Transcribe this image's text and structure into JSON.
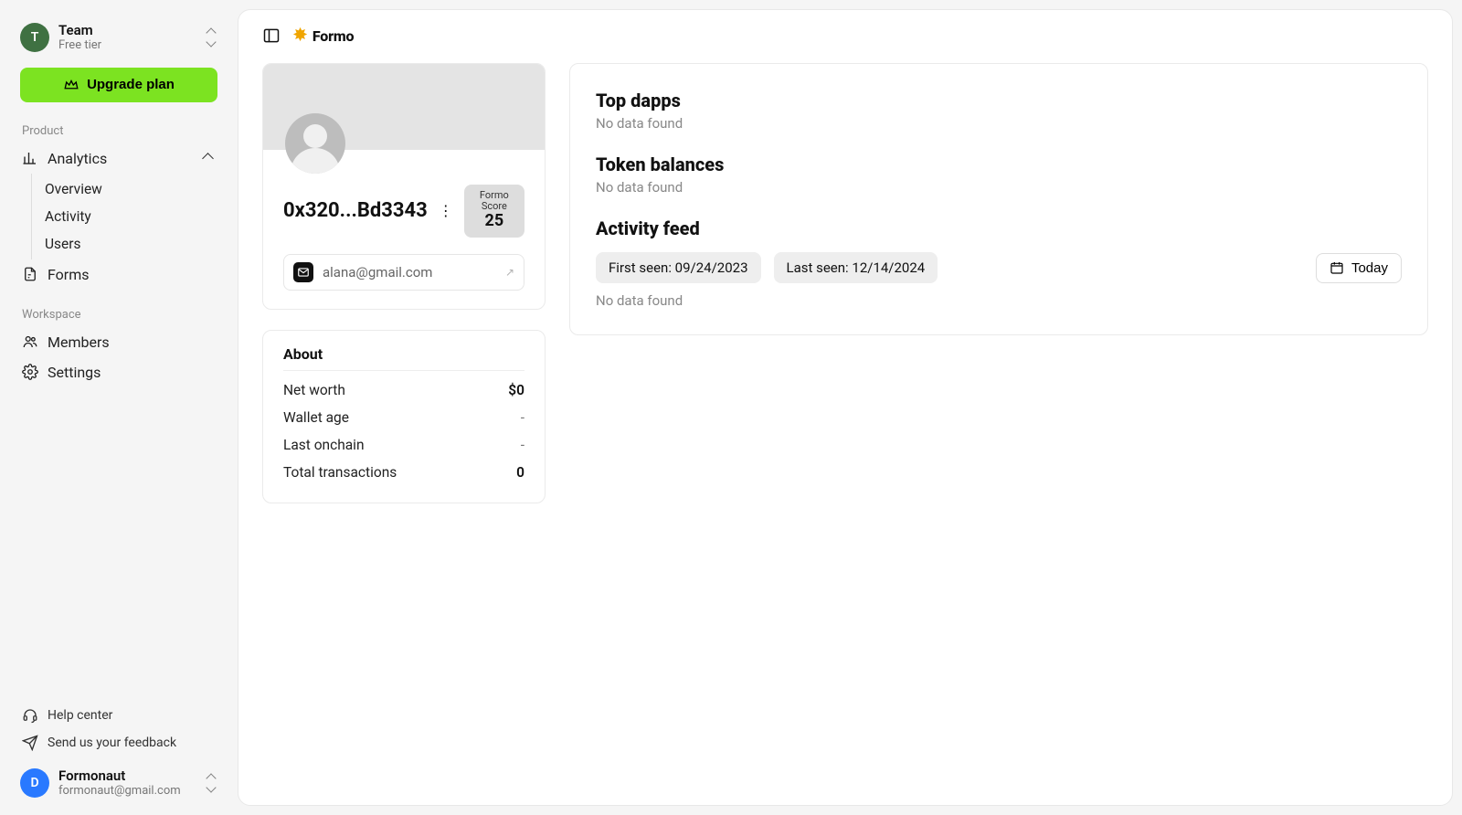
{
  "sidebar": {
    "team": {
      "avatar_initial": "T",
      "name": "Team",
      "tier": "Free tier"
    },
    "upgrade_label": "Upgrade plan",
    "sections": {
      "product_label": "Product",
      "workspace_label": "Workspace"
    },
    "analytics": {
      "label": "Analytics",
      "children": {
        "overview": "Overview",
        "activity": "Activity",
        "users": "Users"
      }
    },
    "forms_label": "Forms",
    "members_label": "Members",
    "settings_label": "Settings",
    "help_label": "Help center",
    "feedback_label": "Send us your feedback",
    "user": {
      "avatar_initial": "D",
      "name": "Formonaut",
      "email": "formonaut@gmail.com"
    }
  },
  "brand": {
    "name": "Formo"
  },
  "profile": {
    "wallet_short": "0x320...Bd3343",
    "score_label": "Formo Score",
    "score_value": "25",
    "email": "alana@gmail.com"
  },
  "about": {
    "title": "About",
    "rows": {
      "net_worth": {
        "k": "Net worth",
        "v": "$0"
      },
      "wallet_age": {
        "k": "Wallet age",
        "v": "-"
      },
      "last_onchain": {
        "k": "Last onchain",
        "v": "-"
      },
      "total_tx": {
        "k": "Total transactions",
        "v": "0"
      }
    }
  },
  "right": {
    "dapps_title": "Top dapps",
    "dapps_empty": "No data found",
    "balances_title": "Token balances",
    "balances_empty": "No data found",
    "feed_title": "Activity feed",
    "first_seen": "First seen: 09/24/2023",
    "last_seen": "Last seen: 12/14/2024",
    "today_label": "Today",
    "feed_empty": "No data found"
  }
}
